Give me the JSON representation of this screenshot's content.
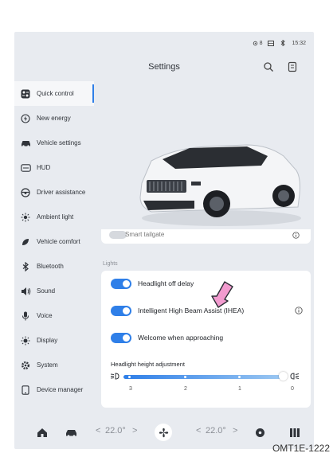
{
  "status": {
    "signal": "8",
    "time": "15:32"
  },
  "header": {
    "title": "Settings"
  },
  "sidebar": {
    "items": [
      {
        "label": "Quick control",
        "icon": "quick-control-icon",
        "active": true
      },
      {
        "label": "New energy",
        "icon": "new-energy-icon"
      },
      {
        "label": "Vehicle settings",
        "icon": "car-icon"
      },
      {
        "label": "HUD",
        "icon": "hud-icon"
      },
      {
        "label": "Driver assistance",
        "icon": "steering-wheel-icon"
      },
      {
        "label": "Ambient light",
        "icon": "ambient-light-icon"
      },
      {
        "label": "Vehicle comfort",
        "icon": "comfort-icon"
      },
      {
        "label": "Bluetooth",
        "icon": "bluetooth-icon"
      },
      {
        "label": "Sound",
        "icon": "speaker-icon"
      },
      {
        "label": "Voice",
        "icon": "microphone-icon"
      },
      {
        "label": "Display",
        "icon": "brightness-icon"
      },
      {
        "label": "System",
        "icon": "gear-icon"
      },
      {
        "label": "Device manager",
        "icon": "device-icon"
      }
    ]
  },
  "partial_row": {
    "label": "Smart tailgate"
  },
  "lights": {
    "section_label": "Lights",
    "rows": [
      {
        "label": "Headlight off delay",
        "on": true
      },
      {
        "label": "Intelligent High Beam Assist (IHEA)",
        "on": true
      },
      {
        "label": "Welcome when approaching",
        "on": true
      }
    ],
    "height_adjustment": {
      "label": "Headlight height adjustment",
      "ticks": [
        "3",
        "2",
        "1",
        "0"
      ],
      "value": "0"
    }
  },
  "dock": {
    "temp_left": "22.0°",
    "temp_right": "22.0°",
    "chev_left": "<",
    "chev_right": ">"
  },
  "caption": "OMT1E-1222",
  "colors": {
    "accent": "#2f7fe8",
    "arrow": "#f29bcf"
  }
}
